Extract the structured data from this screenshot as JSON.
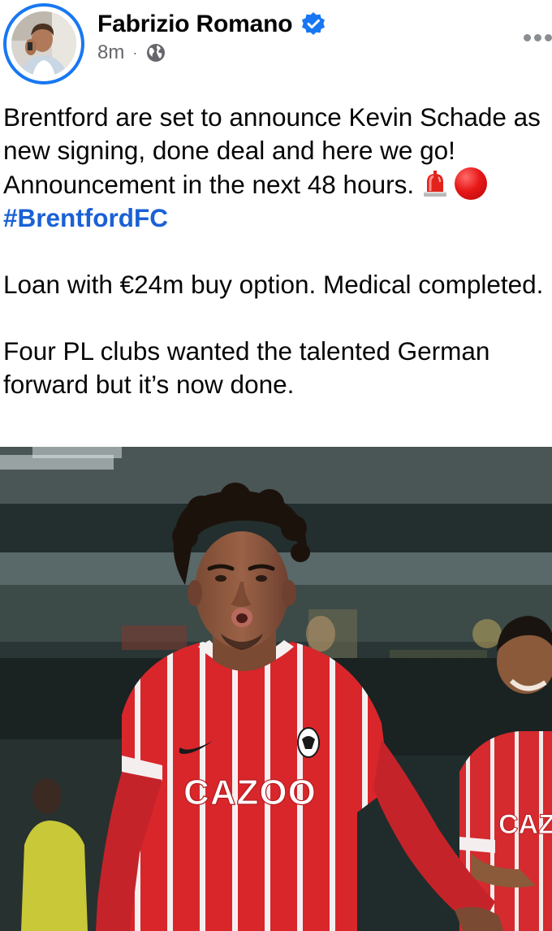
{
  "post": {
    "author": {
      "name": "Fabrizio Romano",
      "verified_icon": "verified-badge-icon",
      "avatar_icon": "profile-avatar"
    },
    "meta": {
      "time": "8m",
      "separator": "·",
      "audience_icon": "globe-icon"
    },
    "more_icon": "more-horizontal-icon",
    "text": {
      "line1": "Brentford are set to announce Kevin Schade as new signing, done deal and here we go! Announcement in the next 48 hours.",
      "hashtag": "#BrentfordFC",
      "para2": "Loan with €24m buy option. Medical completed.",
      "para3": "Four PL clubs wanted the talented German forward but it’s now done."
    },
    "image": {
      "sponsor_main": "CAZOO",
      "sponsor_right": "CAZ"
    },
    "colors": {
      "accent": "#1877f2",
      "hashtag": "#1a61d6",
      "meta": "#65676b",
      "kit_red": "#d9262b"
    }
  }
}
